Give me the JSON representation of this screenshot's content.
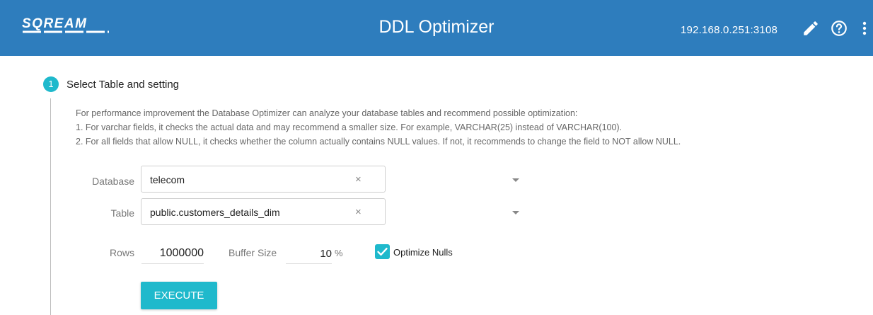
{
  "header": {
    "logo_text": "SQREAM",
    "title": "DDL Optimizer",
    "server_address": "192.168.0.251:3108",
    "icons": [
      "pencil-icon",
      "help-circle-icon",
      "more-vertical-icon"
    ],
    "background_color": "#2e7dbd"
  },
  "step": {
    "number": "1",
    "title": "Select Table and setting",
    "accent_color": "#1fb9cc"
  },
  "description": {
    "intro": "For performance improvement the Database Optimizer can analyze your database tables and recommend possible optimization:",
    "item1": "1. For varchar fields, it checks the actual data and may recommend a smaller size. For example, VARCHAR(25) instead of VARCHAR(100).",
    "item2": "2. For all fields that allow NULL, it checks whether the column actually contains NULL values. If not, it recommends to change the field to NOT allow NULL."
  },
  "form": {
    "database_label": "Database",
    "database_value": "telecom",
    "table_label": "Table",
    "table_value": "public.customers_details_dim",
    "clear_symbol": "×",
    "rows_label": "Rows",
    "rows_value": "1000000",
    "buffer_label": "Buffer Size",
    "buffer_value": "10",
    "percent_symbol": "%",
    "optimize_nulls_label": "Optimize Nulls",
    "optimize_nulls_checked": true,
    "execute_label": "EXECUTE"
  }
}
